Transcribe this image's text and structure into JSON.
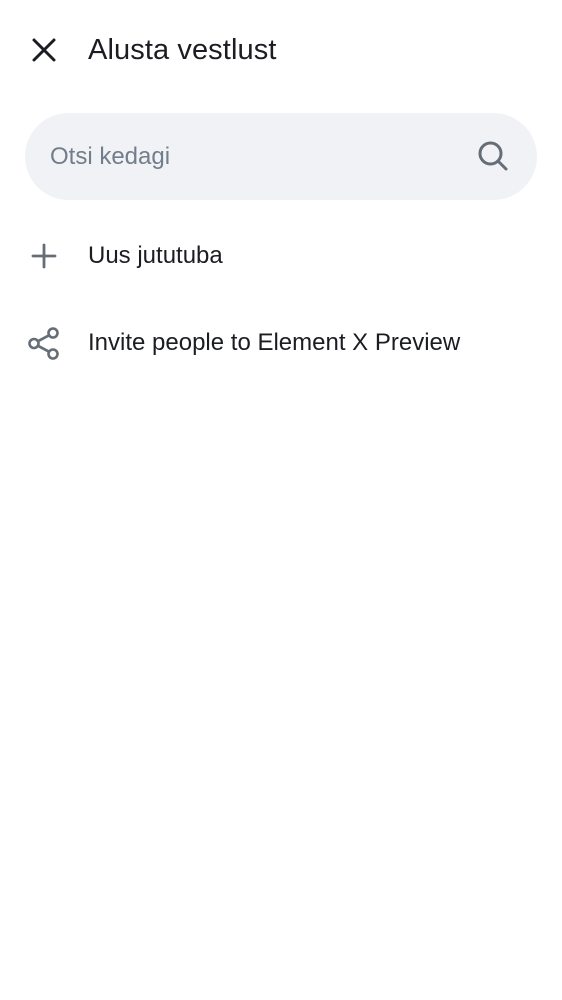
{
  "header": {
    "title": "Alusta vestlust",
    "close_icon": "close-icon"
  },
  "search": {
    "placeholder": "Otsi kedagi",
    "value": "",
    "icon": "search-icon"
  },
  "actions": [
    {
      "icon": "plus-icon",
      "label": "Uus jututuba"
    },
    {
      "icon": "share-icon",
      "label": "Invite people to Element X Preview"
    }
  ],
  "colors": {
    "text": "#1b1d22",
    "icon": "#656d77",
    "search_bg": "#f0f2f5",
    "placeholder": "#737d8c"
  }
}
